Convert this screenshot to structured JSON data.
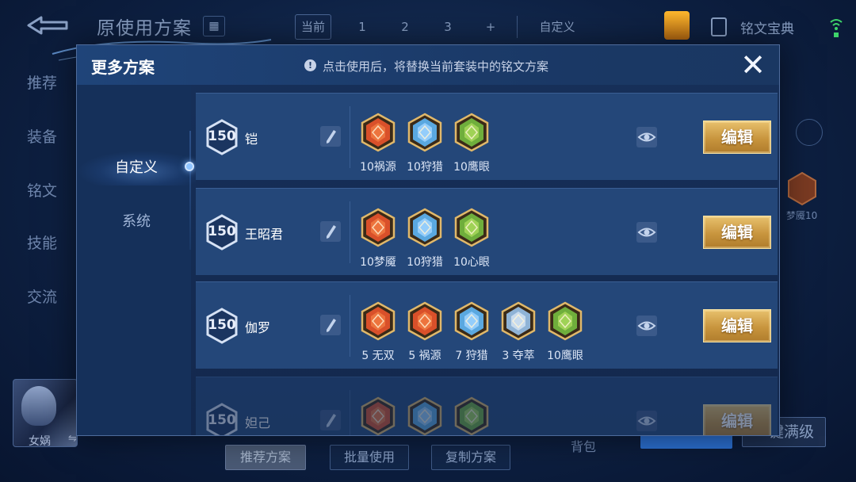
{
  "background": {
    "title": "原使用方案",
    "tabs": [
      "当前",
      "1",
      "2",
      "3",
      "+"
    ],
    "custom_label": "自定义",
    "treasure_label": "铭文宝典",
    "side_nav": [
      "推荐",
      "装备",
      "铭文",
      "技能",
      "交流"
    ],
    "avatar_name": "女娲",
    "swap_glyph": "⇋",
    "bottom_buttons": [
      "推荐方案",
      "批量使用",
      "复制方案"
    ],
    "bag_label": "背包",
    "max_level_label": "一键满级",
    "side_rune_label": "梦魇10"
  },
  "modal": {
    "title": "更多方案",
    "info_glyph": "!",
    "hint": "点击使用后，将替换当前套装中的铭文方案",
    "close_glyph": "✕",
    "left_tabs": [
      "自定义",
      "系统"
    ],
    "edit_label": "编辑",
    "schemes": [
      {
        "level": "150",
        "hero": "铠",
        "runes": [
          {
            "label": "10祸源",
            "icon": "red-rune",
            "color": "#d9502a"
          },
          {
            "label": "10狩猎",
            "icon": "blue-rune",
            "color": "#5aa8e0"
          },
          {
            "label": "10鹰眼",
            "icon": "green-rune",
            "color": "#6fae3c"
          }
        ]
      },
      {
        "level": "150",
        "hero": "王昭君",
        "runes": [
          {
            "label": "10梦魇",
            "icon": "red-rune",
            "color": "#d9502a"
          },
          {
            "label": "10狩猎",
            "icon": "blue-rune",
            "color": "#5aa8e0"
          },
          {
            "label": "10心眼",
            "icon": "green-rune",
            "color": "#6fae3c"
          }
        ]
      },
      {
        "level": "150",
        "hero": "伽罗",
        "runes": [
          {
            "label": "5 无双",
            "icon": "red-rune",
            "color": "#d9502a"
          },
          {
            "label": "5 祸源",
            "icon": "red-rune",
            "color": "#d9502a"
          },
          {
            "label": "7 狩猎",
            "icon": "blue-rune",
            "color": "#5aa8e0"
          },
          {
            "label": "3 夺萃",
            "icon": "blue-rune",
            "color": "#8fb3d6"
          },
          {
            "label": "10鹰眼",
            "icon": "green-rune",
            "color": "#6fae3c"
          }
        ]
      },
      {
        "level": "150",
        "hero": "妲己",
        "runes": [
          {
            "label": "",
            "icon": "red-rune",
            "color": "#d9502a"
          },
          {
            "label": "",
            "icon": "blue-rune",
            "color": "#5aa8e0"
          },
          {
            "label": "",
            "icon": "green-rune",
            "color": "#6fae3c"
          }
        ]
      }
    ]
  }
}
